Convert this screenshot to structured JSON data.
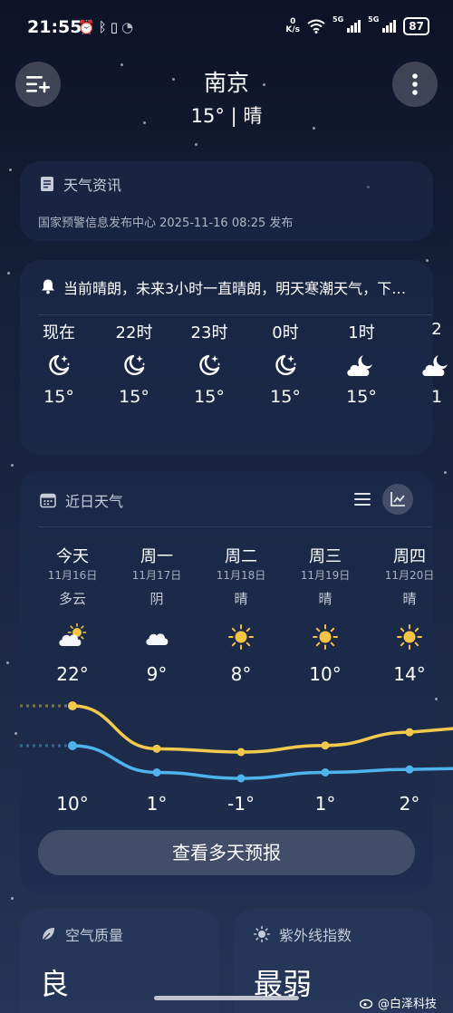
{
  "status_bar": {
    "time": "21:55",
    "left_icons": [
      "alarm-icon",
      "bluetooth-icon",
      "vibrate-icon",
      "wifi-off-icon"
    ],
    "net_speed_top": "0",
    "net_speed_bottom": "K/s",
    "sim1": "5G",
    "sim2": "5G",
    "battery": "87"
  },
  "header": {
    "city": "南京",
    "current": "15° | 晴"
  },
  "news": {
    "title": "天气资讯",
    "subtitle": "国家预警信息发布中心 2025-11-16 08:25 发布"
  },
  "alert": {
    "message": "当前晴朗，未来3小时一直晴朗，明天寒潮天气，下…",
    "hours": [
      {
        "label": "现在",
        "icon": "moon-stars",
        "temp": "15°"
      },
      {
        "label": "22时",
        "icon": "moon-stars",
        "temp": "15°"
      },
      {
        "label": "23时",
        "icon": "moon-stars",
        "temp": "15°"
      },
      {
        "label": "0时",
        "icon": "moon-stars",
        "temp": "15°"
      },
      {
        "label": "1时",
        "icon": "moon-cloud",
        "temp": "15°"
      },
      {
        "label": "2",
        "icon": "moon-cloud",
        "temp": "1"
      }
    ]
  },
  "daily": {
    "title": "近日天气",
    "days": [
      {
        "name": "今天",
        "date": "11月16日",
        "cond": "多云",
        "icon": "sun-cloud",
        "high": 22,
        "high_label": "22°",
        "low": 10,
        "low_label": "10°"
      },
      {
        "name": "周一",
        "date": "11月17日",
        "cond": "阴",
        "icon": "cloud",
        "high": 9,
        "high_label": "9°",
        "low": 1,
        "low_label": "1°"
      },
      {
        "name": "周二",
        "date": "11月18日",
        "cond": "晴",
        "icon": "sun",
        "high": 8,
        "high_label": "8°",
        "low": -1,
        "low_label": "-1°"
      },
      {
        "name": "周三",
        "date": "11月19日",
        "cond": "晴",
        "icon": "sun",
        "high": 10,
        "high_label": "10°",
        "low": 1,
        "low_label": "1°"
      },
      {
        "name": "周四",
        "date": "11月20日",
        "cond": "晴",
        "icon": "sun",
        "high": 14,
        "high_label": "14°",
        "low": 2,
        "low_label": "2°"
      }
    ],
    "more_button": "查看多天预报"
  },
  "air_quality": {
    "title": "空气质量",
    "value": "良"
  },
  "uv": {
    "title": "紫外线指数",
    "value": "最弱"
  },
  "watermark": "@白泽科技",
  "colors": {
    "high_line": "#f2c94c",
    "low_line": "#4fb3ee",
    "sun": "#f6c445"
  }
}
